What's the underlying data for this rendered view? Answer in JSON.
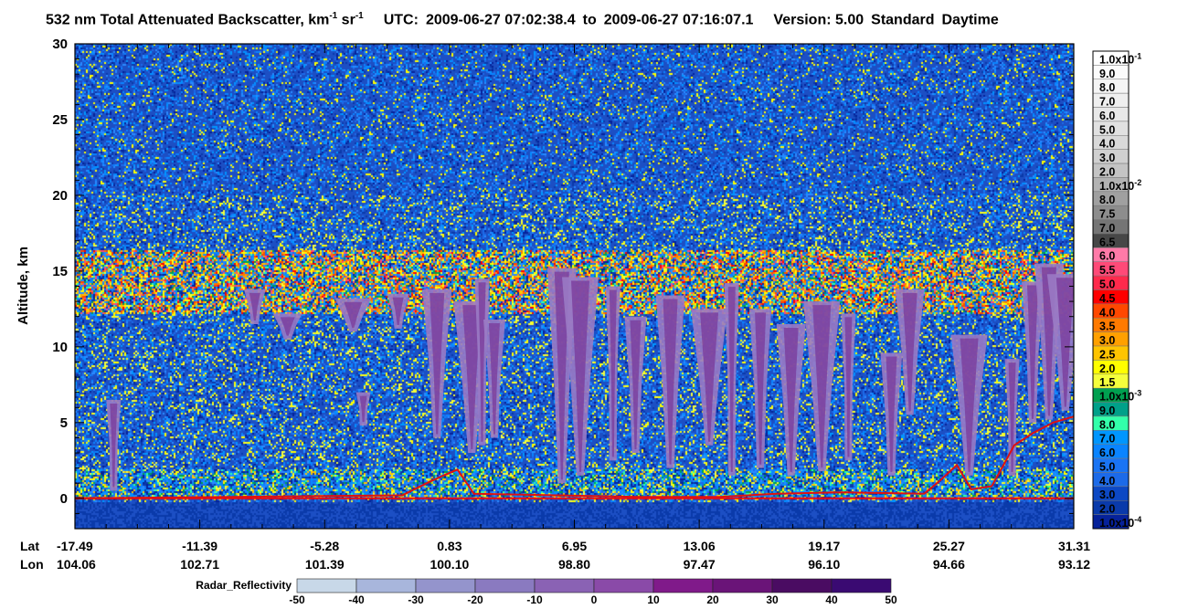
{
  "title": {
    "main": "532 nm Total Attenuated Backscatter, km",
    "exp1": "-1",
    "unit2": " sr",
    "exp2": "-1",
    "utc_label": "UTC:",
    "start": "2009-06-27 07:02:38.4",
    "to_word": "to",
    "end": "2009-06-27 07:16:07.1",
    "version": "Version: 5.00",
    "product": "Standard",
    "mode": "Daytime"
  },
  "chart_data": {
    "type": "heatmap",
    "ylabel": "Altitude, km",
    "ylim": [
      -2,
      30
    ],
    "y_ticks": [
      0,
      5,
      10,
      15,
      20,
      25,
      30
    ],
    "nav": {
      "lat_label": "Lat",
      "lon_label": "Lon",
      "lat": [
        "-17.49",
        "-11.39",
        "-5.28",
        "0.83",
        "6.95",
        "13.06",
        "19.17",
        "25.27",
        "31.31"
      ],
      "lon": [
        "104.06",
        "102.71",
        "101.39",
        "100.10",
        "98.80",
        "97.47",
        "96.10",
        "94.66",
        "93.12"
      ]
    },
    "colorbar": {
      "levels": [
        {
          "label": "1.0x10",
          "exp": "-1",
          "color": "#ffffff"
        },
        {
          "label": "9.0",
          "color": "#fbfbfb"
        },
        {
          "label": "8.0",
          "color": "#f5f5f5"
        },
        {
          "label": "7.0",
          "color": "#efefef"
        },
        {
          "label": "6.0",
          "color": "#e8e8e8"
        },
        {
          "label": "5.0",
          "color": "#e1e1e1"
        },
        {
          "label": "4.0",
          "color": "#d9d9d9"
        },
        {
          "label": "3.0",
          "color": "#d0d0d0"
        },
        {
          "label": "2.0",
          "color": "#c4c4c4"
        },
        {
          "label": "1.0x10",
          "exp": "-2",
          "color": "#b3b3b3"
        },
        {
          "label": "8.0",
          "color": "#a0a0a0"
        },
        {
          "label": "7.5",
          "color": "#8d8d8d"
        },
        {
          "label": "7.0",
          "color": "#757575"
        },
        {
          "label": "6.5",
          "color": "#474747"
        },
        {
          "label": "6.0",
          "color": "#ff7aa8"
        },
        {
          "label": "5.5",
          "color": "#ff4a78"
        },
        {
          "label": "5.0",
          "color": "#ff2a4c"
        },
        {
          "label": "4.5",
          "color": "#ff0000"
        },
        {
          "label": "4.0",
          "color": "#ff4800"
        },
        {
          "label": "3.5",
          "color": "#ff7a00"
        },
        {
          "label": "3.0",
          "color": "#ffa000"
        },
        {
          "label": "2.5",
          "color": "#ffc400"
        },
        {
          "label": "2.0",
          "color": "#ffff00"
        },
        {
          "label": "1.5",
          "color": "#f5ff3c"
        },
        {
          "label": "1.0x10",
          "exp": "-3",
          "color": "#00a050"
        },
        {
          "label": "9.0",
          "color": "#00a089"
        },
        {
          "label": "8.0",
          "color": "#33ffaa"
        },
        {
          "label": "7.0",
          "color": "#0096ff"
        },
        {
          "label": "6.0",
          "color": "#0a84ff"
        },
        {
          "label": "5.0",
          "color": "#1a74f4"
        },
        {
          "label": "4.0",
          "color": "#1c6ae8"
        },
        {
          "label": "3.0",
          "color": "#0c48c4"
        },
        {
          "label": "2.0",
          "color": "#0a3aaa"
        },
        {
          "label": "1.0x10",
          "exp": "-4",
          "color": "#06229a"
        }
      ]
    },
    "radar_legend": {
      "label": "Radar_Reflectivity",
      "ticks": [
        "-50",
        "-40",
        "-30",
        "-20",
        "-10",
        "0",
        "10",
        "20",
        "30",
        "40",
        "50"
      ],
      "colors": [
        "#c8d8e8",
        "#a8b6dc",
        "#9494cc",
        "#8a7ac0",
        "#8a62b4",
        "#8a4aa8",
        "#801a8a",
        "#6a1478",
        "#4a0c62",
        "#3a0a72"
      ]
    },
    "features": {
      "surface_altitude_km": 0,
      "tropopause_layer_km": [
        12.5,
        16.5
      ],
      "boundary_layer_top_km": 2,
      "stratosphere_boundary_km": 20
    },
    "radar_plumes": [
      {
        "lat": -15.6,
        "top": 6.5,
        "bottom": 0.5
      },
      {
        "lat": -8.7,
        "top": 13.8,
        "bottom": 11.5
      },
      {
        "lat": -7.1,
        "top": 12.2,
        "bottom": 10.5
      },
      {
        "lat": -3.9,
        "top": 13.2,
        "bottom": 11.0
      },
      {
        "lat": -3.4,
        "top": 7.0,
        "bottom": 4.8
      },
      {
        "lat": -1.7,
        "top": 13.5,
        "bottom": 11.2
      },
      {
        "lat": 0.2,
        "top": 13.8,
        "bottom": 4.0
      },
      {
        "lat": 1.9,
        "top": 13.0,
        "bottom": 3.0
      },
      {
        "lat": 2.4,
        "top": 14.5,
        "bottom": 3.5
      },
      {
        "lat": 3.0,
        "top": 11.8,
        "bottom": 4.0
      },
      {
        "lat": 6.3,
        "top": 15.2,
        "bottom": 1.0
      },
      {
        "lat": 7.2,
        "top": 14.6,
        "bottom": 1.5
      },
      {
        "lat": 8.8,
        "top": 14.0,
        "bottom": 2.5
      },
      {
        "lat": 9.9,
        "top": 12.0,
        "bottom": 3.0
      },
      {
        "lat": 11.6,
        "top": 13.4,
        "bottom": 2.0
      },
      {
        "lat": 13.5,
        "top": 12.5,
        "bottom": 3.5
      },
      {
        "lat": 14.6,
        "top": 14.2,
        "bottom": 1.5
      },
      {
        "lat": 16.0,
        "top": 12.5,
        "bottom": 2.0
      },
      {
        "lat": 17.5,
        "top": 11.5,
        "bottom": 1.5
      },
      {
        "lat": 19.0,
        "top": 13.0,
        "bottom": 1.8
      },
      {
        "lat": 20.3,
        "top": 12.2,
        "bottom": 2.5
      },
      {
        "lat": 22.4,
        "top": 9.6,
        "bottom": 1.5
      },
      {
        "lat": 23.3,
        "top": 13.8,
        "bottom": 5.5
      },
      {
        "lat": 26.2,
        "top": 10.8,
        "bottom": 1.5
      },
      {
        "lat": 28.3,
        "top": 9.2,
        "bottom": 1.5
      },
      {
        "lat": 29.3,
        "top": 14.3,
        "bottom": 5.0
      },
      {
        "lat": 30.1,
        "top": 15.5,
        "bottom": 5.2
      },
      {
        "lat": 30.9,
        "top": 14.8,
        "bottom": 5.8
      }
    ],
    "surface_trace": [
      {
        "lat": -17.49,
        "alt": 0.0
      },
      {
        "lat": -1.5,
        "alt": 0.2
      },
      {
        "lat": -0.3,
        "alt": 1.0
      },
      {
        "lat": 0.5,
        "alt": 1.5
      },
      {
        "lat": 1.2,
        "alt": 1.9
      },
      {
        "lat": 2.0,
        "alt": 0.3
      },
      {
        "lat": 10.0,
        "alt": 0.1
      },
      {
        "lat": 14.0,
        "alt": 0.1
      },
      {
        "lat": 16.8,
        "alt": 0.3
      },
      {
        "lat": 20.0,
        "alt": 0.4
      },
      {
        "lat": 24.0,
        "alt": 0.3
      },
      {
        "lat": 24.8,
        "alt": 1.2
      },
      {
        "lat": 25.6,
        "alt": 2.2
      },
      {
        "lat": 26.3,
        "alt": 0.6
      },
      {
        "lat": 27.3,
        "alt": 0.8
      },
      {
        "lat": 27.8,
        "alt": 2.0
      },
      {
        "lat": 28.4,
        "alt": 3.5
      },
      {
        "lat": 29.3,
        "alt": 4.3
      },
      {
        "lat": 30.3,
        "alt": 5.0
      },
      {
        "lat": 31.31,
        "alt": 5.4
      }
    ]
  }
}
